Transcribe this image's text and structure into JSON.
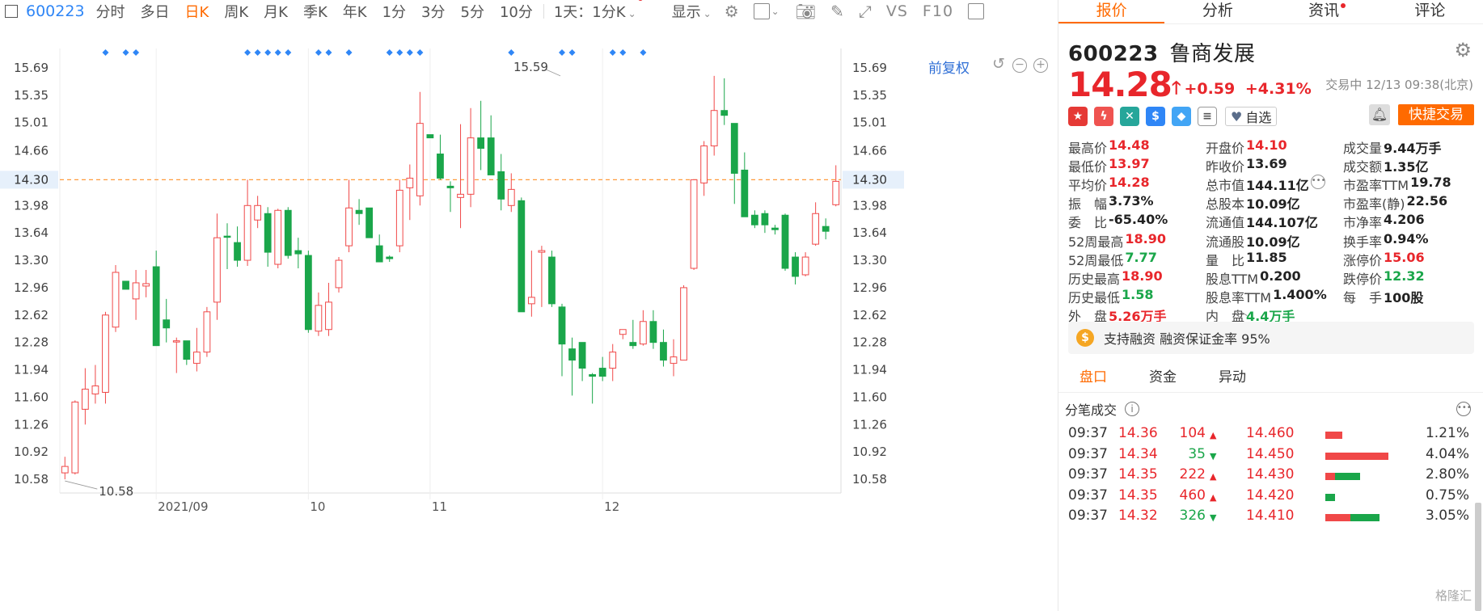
{
  "toolbar": {
    "code": "600223",
    "tabs": [
      "分时",
      "多日",
      "日K",
      "周K",
      "月K",
      "季K",
      "年K",
      "1分",
      "3分",
      "5分",
      "10分"
    ],
    "active_tab": "日K",
    "period_dropdown": "1天：1分K",
    "display_dropdown": "显示",
    "vs_label": "VS",
    "f10_label": "F10"
  },
  "chart": {
    "fuquan_label": "前复权",
    "chart_data": {
      "type": "candlestick",
      "title": "",
      "yticks": [
        15.69,
        15.35,
        15.01,
        14.66,
        14.3,
        13.98,
        13.64,
        13.3,
        12.96,
        12.62,
        12.28,
        11.94,
        11.6,
        11.26,
        10.92,
        10.58
      ],
      "ylim": [
        10.41,
        15.93
      ],
      "current_price": 14.3,
      "current_price_label": "14.30",
      "xlabels": [
        {
          "idx": 9.5,
          "label": "2021/09"
        },
        {
          "idx": 24.5,
          "label": "10"
        },
        {
          "idx": 36.5,
          "label": "11"
        },
        {
          "idx": 53.5,
          "label": "12"
        }
      ],
      "annotations": [
        {
          "idx": 0,
          "price": 10.58,
          "label": "10.58",
          "side": "below"
        },
        {
          "idx": 49,
          "price": 15.59,
          "label": "15.59",
          "side": "above"
        }
      ],
      "markers_idx": [
        4,
        6,
        7,
        18,
        19,
        20,
        21,
        22,
        25,
        26,
        28,
        32,
        33,
        34,
        35,
        44,
        49,
        50,
        54,
        55,
        57
      ],
      "candles": [
        {
          "o": 10.66,
          "h": 10.86,
          "l": 10.58,
          "c": 10.74
        },
        {
          "o": 10.66,
          "h": 11.56,
          "l": 10.64,
          "c": 11.54
        },
        {
          "o": 11.45,
          "h": 11.96,
          "l": 11.26,
          "c": 11.7
        },
        {
          "o": 11.64,
          "h": 12.0,
          "l": 11.52,
          "c": 11.74
        },
        {
          "o": 11.66,
          "h": 12.66,
          "l": 11.52,
          "c": 12.62
        },
        {
          "o": 12.47,
          "h": 13.24,
          "l": 12.41,
          "c": 13.15
        },
        {
          "o": 13.04,
          "h": 13.04,
          "l": 12.96,
          "c": 12.94
        },
        {
          "o": 12.82,
          "h": 13.18,
          "l": 12.56,
          "c": 13.02
        },
        {
          "o": 12.98,
          "h": 13.18,
          "l": 12.84,
          "c": 13.01
        },
        {
          "o": 13.22,
          "h": 13.42,
          "l": 12.36,
          "c": 12.24
        },
        {
          "o": 12.56,
          "h": 12.82,
          "l": 12.28,
          "c": 12.46
        },
        {
          "o": 12.29,
          "h": 12.34,
          "l": 11.9,
          "c": 12.3
        },
        {
          "o": 12.3,
          "h": 12.3,
          "l": 12.0,
          "c": 12.07
        },
        {
          "o": 12.02,
          "h": 12.46,
          "l": 11.92,
          "c": 12.16
        },
        {
          "o": 12.16,
          "h": 12.72,
          "l": 12.1,
          "c": 12.66
        },
        {
          "o": 12.78,
          "h": 13.88,
          "l": 12.56,
          "c": 13.58
        },
        {
          "o": 13.6,
          "h": 13.76,
          "l": 13.19,
          "c": 13.59
        },
        {
          "o": 13.52,
          "h": 13.72,
          "l": 13.22,
          "c": 13.3
        },
        {
          "o": 13.3,
          "h": 14.3,
          "l": 13.23,
          "c": 13.98
        },
        {
          "o": 13.8,
          "h": 14.1,
          "l": 13.7,
          "c": 13.98
        },
        {
          "o": 13.88,
          "h": 13.96,
          "l": 13.22,
          "c": 13.4
        },
        {
          "o": 13.25,
          "h": 13.94,
          "l": 13.2,
          "c": 13.92
        },
        {
          "o": 13.92,
          "h": 13.96,
          "l": 13.32,
          "c": 13.36
        },
        {
          "o": 13.42,
          "h": 13.58,
          "l": 13.2,
          "c": 13.38
        },
        {
          "o": 13.36,
          "h": 13.42,
          "l": 12.4,
          "c": 12.44
        },
        {
          "o": 12.42,
          "h": 12.9,
          "l": 12.36,
          "c": 12.74
        },
        {
          "o": 12.44,
          "h": 13.02,
          "l": 12.36,
          "c": 12.78
        },
        {
          "o": 12.96,
          "h": 13.34,
          "l": 12.9,
          "c": 13.3
        },
        {
          "o": 13.48,
          "h": 14.3,
          "l": 13.4,
          "c": 13.95
        },
        {
          "o": 13.92,
          "h": 14.06,
          "l": 13.74,
          "c": 13.88
        },
        {
          "o": 13.95,
          "h": 13.95,
          "l": 13.58,
          "c": 13.58
        },
        {
          "o": 13.48,
          "h": 13.62,
          "l": 13.3,
          "c": 13.28
        },
        {
          "o": 13.34,
          "h": 13.36,
          "l": 13.28,
          "c": 13.32
        },
        {
          "o": 13.48,
          "h": 14.3,
          "l": 13.4,
          "c": 14.17
        },
        {
          "o": 14.2,
          "h": 14.49,
          "l": 13.8,
          "c": 14.32
        },
        {
          "o": 14.1,
          "h": 15.39,
          "l": 13.98,
          "c": 15.0
        },
        {
          "o": 14.86,
          "h": 14.86,
          "l": 14.82,
          "c": 14.82
        },
        {
          "o": 14.62,
          "h": 14.86,
          "l": 14.3,
          "c": 14.32
        },
        {
          "o": 14.22,
          "h": 14.28,
          "l": 13.9,
          "c": 14.2
        },
        {
          "o": 14.08,
          "h": 14.99,
          "l": 13.7,
          "c": 14.12
        },
        {
          "o": 14.12,
          "h": 15.19,
          "l": 13.96,
          "c": 14.82
        },
        {
          "o": 14.82,
          "h": 15.28,
          "l": 14.42,
          "c": 14.69
        },
        {
          "o": 14.82,
          "h": 15.1,
          "l": 14.38,
          "c": 14.36
        },
        {
          "o": 14.4,
          "h": 14.62,
          "l": 13.92,
          "c": 14.06
        },
        {
          "o": 13.98,
          "h": 14.38,
          "l": 13.9,
          "c": 14.18
        },
        {
          "o": 14.04,
          "h": 14.08,
          "l": 12.66,
          "c": 12.66
        },
        {
          "o": 12.76,
          "h": 13.42,
          "l": 12.6,
          "c": 12.84
        },
        {
          "o": 13.4,
          "h": 13.48,
          "l": 12.72,
          "c": 13.42
        },
        {
          "o": 13.34,
          "h": 13.42,
          "l": 12.72,
          "c": 12.76
        },
        {
          "o": 12.72,
          "h": 12.76,
          "l": 11.86,
          "c": 12.26
        },
        {
          "o": 12.2,
          "h": 12.34,
          "l": 11.62,
          "c": 12.06
        },
        {
          "o": 12.28,
          "h": 12.28,
          "l": 11.8,
          "c": 11.96
        },
        {
          "o": 11.88,
          "h": 11.9,
          "l": 11.52,
          "c": 11.86
        },
        {
          "o": 11.96,
          "h": 12.1,
          "l": 11.8,
          "c": 11.86
        },
        {
          "o": 11.96,
          "h": 12.26,
          "l": 11.8,
          "c": 12.16
        },
        {
          "o": 12.38,
          "h": 12.44,
          "l": 12.32,
          "c": 12.44
        },
        {
          "o": 12.28,
          "h": 12.56,
          "l": 12.2,
          "c": 12.24
        },
        {
          "o": 12.26,
          "h": 12.68,
          "l": 12.24,
          "c": 12.54
        },
        {
          "o": 12.54,
          "h": 12.68,
          "l": 12.2,
          "c": 12.28
        },
        {
          "o": 12.28,
          "h": 12.44,
          "l": 11.98,
          "c": 12.06
        },
        {
          "o": 12.02,
          "h": 12.32,
          "l": 11.86,
          "c": 12.1
        },
        {
          "o": 12.06,
          "h": 12.99,
          "l": 12.06,
          "c": 12.96
        },
        {
          "o": 13.2,
          "h": 14.3,
          "l": 13.18,
          "c": 14.3
        },
        {
          "o": 14.26,
          "h": 14.78,
          "l": 14.1,
          "c": 14.72
        },
        {
          "o": 14.72,
          "h": 15.59,
          "l": 14.6,
          "c": 15.16
        },
        {
          "o": 15.16,
          "h": 15.56,
          "l": 14.98,
          "c": 15.1
        },
        {
          "o": 15.0,
          "h": 15.0,
          "l": 14.0,
          "c": 14.38
        },
        {
          "o": 14.42,
          "h": 14.64,
          "l": 13.84,
          "c": 13.84
        },
        {
          "o": 13.86,
          "h": 13.92,
          "l": 13.7,
          "c": 13.74
        },
        {
          "o": 13.88,
          "h": 13.92,
          "l": 13.64,
          "c": 13.74
        },
        {
          "o": 13.7,
          "h": 13.74,
          "l": 13.62,
          "c": 13.68
        },
        {
          "o": 13.86,
          "h": 13.88,
          "l": 13.17,
          "c": 13.2
        },
        {
          "o": 13.34,
          "h": 13.4,
          "l": 13.0,
          "c": 13.1
        },
        {
          "o": 13.12,
          "h": 13.4,
          "l": 13.1,
          "c": 13.34
        },
        {
          "o": 13.5,
          "h": 14.02,
          "l": 13.48,
          "c": 13.88
        },
        {
          "o": 13.72,
          "h": 13.82,
          "l": 13.56,
          "c": 13.66
        },
        {
          "o": 13.99,
          "h": 14.48,
          "l": 13.97,
          "c": 14.28
        }
      ]
    }
  },
  "panel": {
    "tabs": [
      "报价",
      "分析",
      "资讯",
      "评论"
    ],
    "active_tab": "报价",
    "code": "600223",
    "name": "鲁商发展",
    "price": "14.28",
    "change": "+0.59",
    "change_pct": "+4.31%",
    "status": "交易中 12/13 09:38(北京)",
    "zixuan": "自选",
    "quick_trade": "快捷交易",
    "stats": [
      [
        {
          "l": "最高价",
          "v": "14.48",
          "c": "red"
        },
        {
          "l": "开盘价",
          "v": "14.10",
          "c": "red"
        },
        {
          "l": "成交量",
          "v": "9.44万手",
          "c": ""
        }
      ],
      [
        {
          "l": "最低价",
          "v": "13.97",
          "c": "red"
        },
        {
          "l": "昨收价",
          "v": "13.69",
          "c": ""
        },
        {
          "l": "成交额",
          "v": "1.35亿",
          "c": ""
        }
      ],
      [
        {
          "l": "平均价",
          "v": "14.28",
          "c": "red"
        },
        {
          "l": "总市值",
          "v": "144.11亿",
          "c": ""
        },
        {
          "l": "市盈率TTM",
          "v": "19.78",
          "c": ""
        }
      ],
      [
        {
          "l": "振　幅",
          "v": "3.73%",
          "c": ""
        },
        {
          "l": "总股本",
          "v": "10.09亿",
          "c": ""
        },
        {
          "l": "市盈率(静)",
          "v": "22.56",
          "c": ""
        }
      ],
      [
        {
          "l": "委　比",
          "v": "-65.40%",
          "c": ""
        },
        {
          "l": "流通值",
          "v": "144.107亿",
          "c": ""
        },
        {
          "l": "市净率",
          "v": "4.206",
          "c": ""
        }
      ],
      [
        {
          "l": "52周最高",
          "v": "18.90",
          "c": "red"
        },
        {
          "l": "流通股",
          "v": "10.09亿",
          "c": ""
        },
        {
          "l": "换手率",
          "v": "0.94%",
          "c": ""
        }
      ],
      [
        {
          "l": "52周最低",
          "v": "7.77",
          "c": "green"
        },
        {
          "l": "量　比",
          "v": "11.85",
          "c": ""
        },
        {
          "l": "涨停价",
          "v": "15.06",
          "c": "red"
        }
      ],
      [
        {
          "l": "历史最高",
          "v": "18.90",
          "c": "red"
        },
        {
          "l": "股息TTM",
          "v": "0.200",
          "c": ""
        },
        {
          "l": "跌停价",
          "v": "12.32",
          "c": "green"
        }
      ],
      [
        {
          "l": "历史最低",
          "v": "1.58",
          "c": "green"
        },
        {
          "l": "股息率TTM",
          "v": "1.400%",
          "c": ""
        },
        {
          "l": "每　手",
          "v": "100股",
          "c": ""
        }
      ],
      [
        {
          "l": "外　盘",
          "v": "5.26万手",
          "c": "red"
        },
        {
          "l": "内　盘",
          "v": "4.4万手",
          "c": "green"
        },
        {
          "l": "",
          "v": "",
          "c": ""
        }
      ]
    ],
    "rongzi": "支持融资 融资保证金率 95%",
    "subtabs": [
      "盘口",
      "资金",
      "异动"
    ],
    "active_subtab": "盘口",
    "ticks_title": "分笔成交",
    "ticks": [
      {
        "time": "09:37",
        "px": "14.36",
        "vol": "104",
        "dir": "up",
        "lv": "14.460",
        "pct": "1.21%",
        "bar_red": 0.2,
        "bar_green": 0
      },
      {
        "time": "09:37",
        "px": "14.34",
        "vol": "35",
        "dir": "down",
        "lv": "14.450",
        "pct": "4.04%",
        "bar_red": 0.75,
        "bar_green": 0
      },
      {
        "time": "09:37",
        "px": "14.35",
        "vol": "222",
        "dir": "up",
        "lv": "14.430",
        "pct": "2.80%",
        "bar_red": 0.12,
        "bar_green": 0.3
      },
      {
        "time": "09:37",
        "px": "14.35",
        "vol": "460",
        "dir": "up",
        "lv": "14.420",
        "pct": "0.75%",
        "bar_red": 0,
        "bar_green": 0.12
      },
      {
        "time": "09:37",
        "px": "14.32",
        "vol": "326",
        "dir": "down",
        "lv": "14.410",
        "pct": "3.05%",
        "bar_red": 0.3,
        "bar_green": 0.35
      }
    ],
    "watermark": "格隆汇"
  },
  "colors": {
    "up": "#f04848",
    "down": "#1aa64a",
    "accent": "#ff6a00",
    "price_line": "#ff9a3c"
  }
}
